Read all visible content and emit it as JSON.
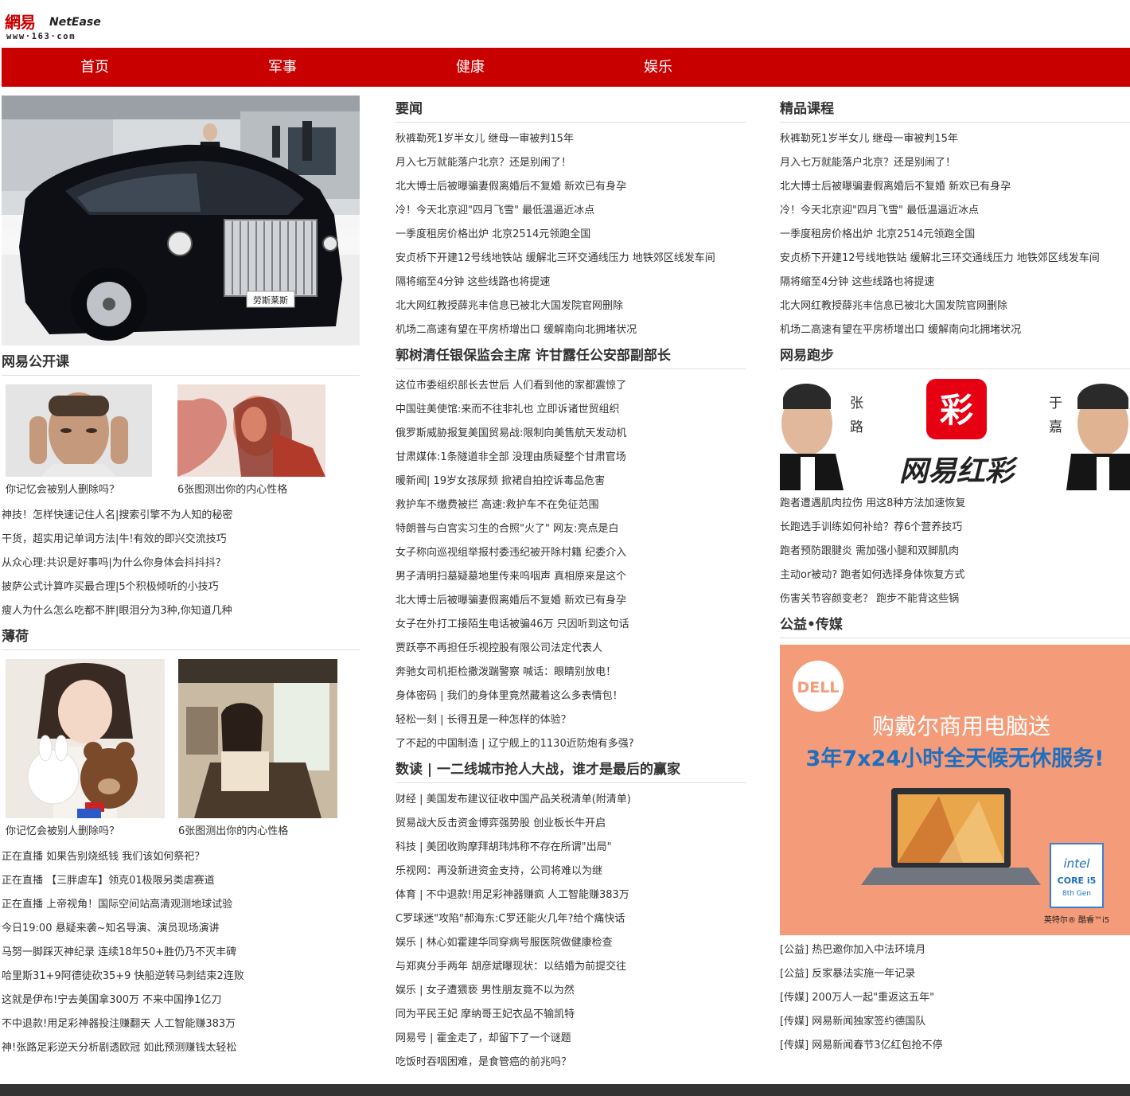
{
  "logo": {
    "cn": "網易",
    "en": "NetEase",
    "url": "www·163·com"
  },
  "nav": [
    "首页",
    "军事",
    "健康",
    "娱乐"
  ],
  "left": {
    "gongkaike_title": "网易公开课",
    "gongkaike_thumbs": [
      "你记忆会被别人删除吗？",
      "6张图测出你的内心性格"
    ],
    "gongkaike_list": [
      "神技！怎样快速记住人名|搜索引擎不为人知的秘密",
      "干货，超实用记单词方法|牛!有效的即兴交流技巧",
      "从众心理:共识是好事吗|为什么你身体会抖抖抖？",
      "披萨公式计算咋买最合理|5个积极倾听的小技巧",
      "瘦人为什么怎么吃都不胖|眼泪分为3种,你知道几种"
    ],
    "bohe_title": "薄荷",
    "bohe_thumbs": [
      "你记忆会被别人删除吗？",
      "6张图测出你的内心性格"
    ],
    "bohe_list": [
      "正在直播 如果告别烧纸钱 我们该如何祭祀？",
      "正在直播 【三胖虐车】领克01极限另类虐赛道",
      "正在直播 上帝视角！国际空间站高清观测地球试验",
      "今日19:00 悬疑来袭~知名导演、演员现场演讲",
      "马努一脚踩灭神纪录 连续18年50+胜仍乃不灭丰碑",
      "哈里斯31+9阿德徒砍35+9 快船逆转马刺结束2连败",
      "这就是伊布!宁去美国拿300万 不来中国挣1亿刀",
      "不中退款!用足彩神器投注赚翻天 人工智能赚383万",
      "神!张路足彩逆天分析剧透欧冠 如此预测赚钱太轻松"
    ],
    "hero_plate": "劳斯莱斯"
  },
  "mid": {
    "yaowen_title": "要闻",
    "yaowen_list": [
      "秋裤勒死1岁半女儿 继母一审被判15年",
      "月入七万就能落户北京？还是别闹了！",
      "北大博士后被曝骗妻假离婚后不复婚 新欢已有身孕",
      "冷！今天北京迎\"四月飞雪\" 最低温逼近冰点",
      "一季度租房价格出炉 北京2514元领跑全国",
      "安贞桥下开建12号线地铁站 缓解北三环交通线压力 地铁郊区线发车间",
      "隔将缩至4分钟 这些线路也将提速",
      "北大网红教授薛兆丰信息已被北大国发院官网删除",
      "机场二高速有望在平房桥增出口 缓解南向北拥堵状况"
    ],
    "sec2_title": "郭树清任银保监会主席 许甘露任公安部副部长",
    "sec2_list": [
      "这位市委组织部长去世后 人们看到他的家都震惊了",
      "中国驻美使馆:来而不往非礼也 立即诉诸世贸组织",
      "俄罗斯威胁报复美国贸易战:限制向美售航天发动机",
      "甘肃媒体:1条隧道非全部 没理由质疑整个甘肃官场",
      "暖新闻| 19岁女孩尿频 掀裙自拍控诉毒品危害",
      "救护车不缴费被拦 高速:救护车不在免征范围",
      "特朗普与白宫实习生的合照\"火了\" 网友:亮点是白",
      "女子称向巡视组举报村委违纪被开除村籍 纪委介入",
      "男子清明扫墓疑墓地里传来呜咽声 真相原来是这个",
      "北大博士后被曝骗妻假离婚后不复婚 新欢已有身孕",
      "女子在外打工接陌生电话被骗46万 只因听到这句话",
      "贾跃亭不再担任乐视控股有限公司法定代表人",
      "奔驰女司机拒检撒泼踹警察 喊话：眼睛别放电！",
      "身体密码 | 我们的身体里竟然藏着这么多表情包！",
      "轻松一刻 | 长得丑是一种怎样的体验？",
      "了不起的中国制造 | 辽宁舰上的1130近防炮有多强?"
    ],
    "sec3_title": "数读 | 一二线城市抢人大战，谁才是最后的赢家",
    "sec3_list": [
      "财经 | 美国发布建议征收中国产品关税清单(附清单)",
      "贸易战大反击资金博弈强势股 创业板长牛开启",
      "科技 | 美团收购摩拜胡玮炜称不存在所谓\"出局\"",
      "乐视网：再没新进资金支持，公司将难以为继",
      "体育 | 不中退款!用足彩神器赚疯 人工智能赚383万",
      "C罗球迷\"攻陷\"郝海东:C罗还能火几年?给个痛快话",
      "娱乐 | 林心如霍建华同穿病号服医院做健康检查",
      "与郑爽分手两年 胡彦斌曝现状：以结婚为前提交往",
      "娱乐 | 女子遭猥亵 男性朋友竟不以为然",
      "同为平民王妃 摩纳哥王妃衣品不输凯特",
      "网易号 | 霍金走了，却留下了一个谜题",
      "吃饭时吞咽困难，是食管癌的前兆吗？"
    ]
  },
  "right": {
    "course_title": "精品课程",
    "course_list": [
      "秋裤勒死1岁半女儿 继母一审被判15年",
      "月入七万就能落户北京？还是别闹了！",
      "北大博士后被曝骗妻假离婚后不复婚 新欢已有身孕",
      "冷！今天北京迎\"四月飞雪\" 最低温逼近冰点",
      "一季度租房价格出炉 北京2514元领跑全国",
      "安贞桥下开建12号线地铁站 缓解北三环交通线压力 地铁郊区线发车间",
      "隔将缩至4分钟 这些线路也将提速",
      "北大网红教授薛兆丰信息已被北大国发院官网删除",
      "机场二高速有望在平房桥增出口 缓解南向北拥堵状况"
    ],
    "run_title": "网易跑步",
    "run_banner": {
      "left_name": [
        "张",
        "路"
      ],
      "right_name": [
        "于",
        "嘉"
      ],
      "logo": "彩",
      "brand": "网易红彩"
    },
    "run_list": [
      "跑者遭遇肌肉拉伤 用这8种方法加速恢复",
      "长跑选手训练如何补给？荐6个营养技巧",
      "跑者预防跟腱炎 需加强小腿和双脚肌肉",
      "主动or被动? 跑者如何选择身体恢复方式",
      "伤害关节容颜变老？ 跑步不能背这些锅"
    ],
    "gongyi_title": "公益•传媒",
    "dell_ad": {
      "brand": "DELL",
      "line1": "购戴尔商用电脑送",
      "line2": "3年7x24小时全天候无休服务!",
      "intel": "intel",
      "core": "CORE i5",
      "gen": "8th Gen",
      "tag": "英特尔® 酷睿™i5"
    },
    "gongyi_list": [
      "[公益] 热巴邀你加入中法环境月",
      "[公益] 反家暴法实施一年记录",
      "[传媒] 200万人一起\"重返这五年\"",
      "[传媒] 网易新闻独家签约德国队",
      "[传媒] 网易新闻春节3亿红包抢不停"
    ]
  },
  "colors": {
    "brand_red": "#c80000",
    "text": "#333333",
    "footer": "#333333",
    "dell_bg": "#f49b79",
    "dell_blue": "#1e6fc0"
  }
}
